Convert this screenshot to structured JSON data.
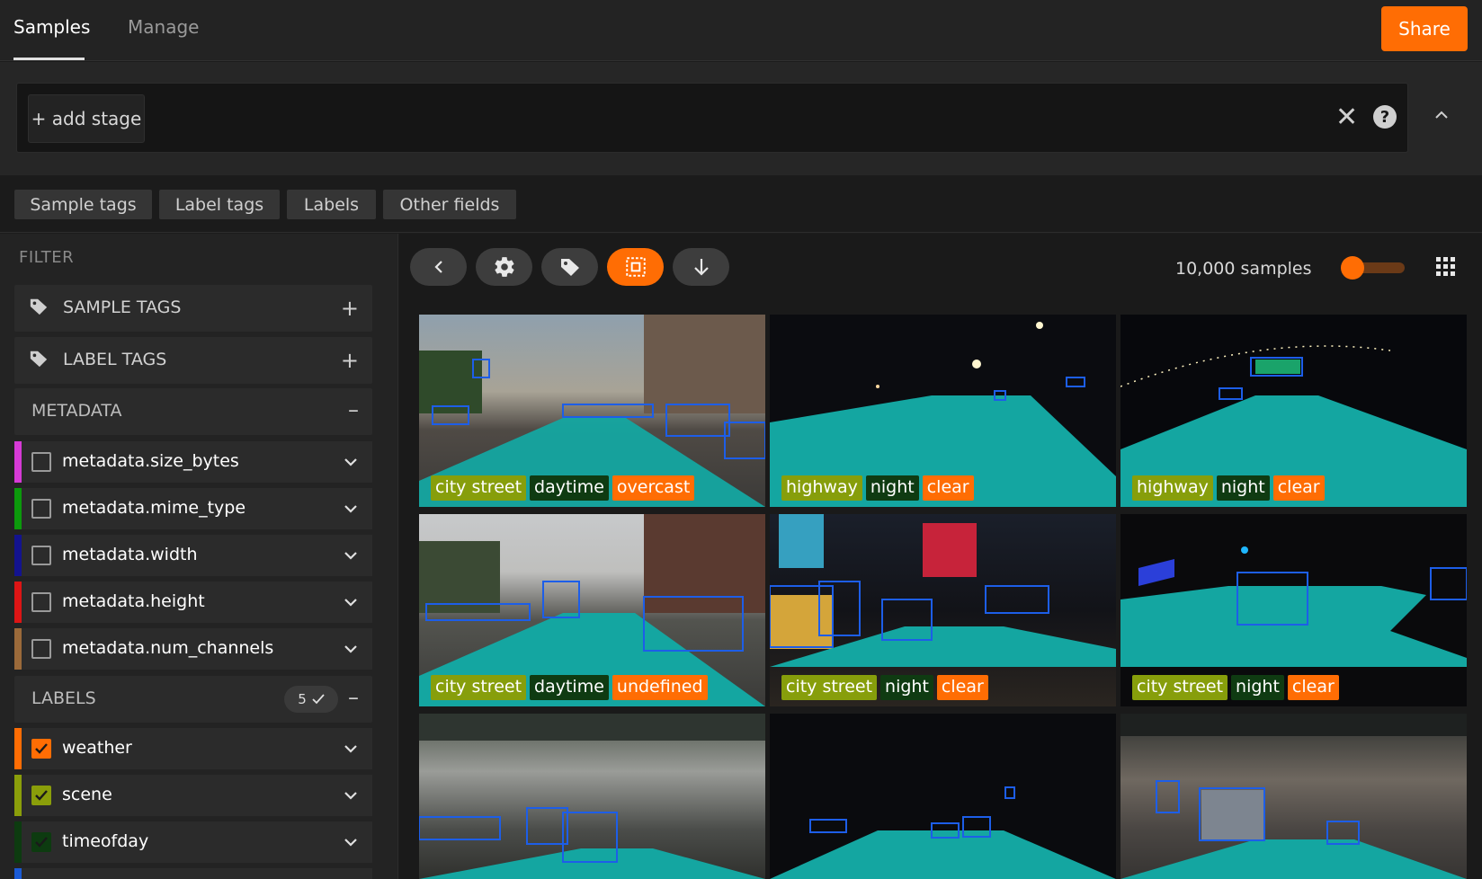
{
  "topbar": {
    "tabs": [
      {
        "label": "Samples"
      },
      {
        "label": "Manage"
      }
    ],
    "share_label": "Share"
  },
  "viewbar": {
    "add_stage_label": "+ add stage",
    "clear_glyph": "✕",
    "help_glyph": "?"
  },
  "sidebar_tabs": [
    {
      "label": "Sample tags"
    },
    {
      "label": "Label tags"
    },
    {
      "label": "Labels"
    },
    {
      "label": "Other fields"
    }
  ],
  "sidebar": {
    "title": "FILTER",
    "groups": {
      "sample_tags": {
        "label": "SAMPLE TAGS"
      },
      "label_tags": {
        "label": "LABEL TAGS"
      },
      "metadata": {
        "label": "METADATA"
      },
      "labels": {
        "label": "LABELS",
        "count": "5"
      }
    },
    "metadata_fields": [
      {
        "label": "metadata.size_bytes",
        "color": "#d63ad6",
        "checked": false
      },
      {
        "label": "metadata.mime_type",
        "color": "#0c9a0c",
        "checked": false
      },
      {
        "label": "metadata.width",
        "color": "#13138f",
        "checked": false
      },
      {
        "label": "metadata.height",
        "color": "#dd1515",
        "checked": false
      },
      {
        "label": "metadata.num_channels",
        "color": "#9b6a3a",
        "checked": false
      }
    ],
    "label_fields": [
      {
        "label": "weather",
        "color": "#ff6d04",
        "checked": true
      },
      {
        "label": "scene",
        "color": "#8a9e0a",
        "checked": true
      },
      {
        "label": "timeofday",
        "color": "#0d3b10",
        "checked": true
      },
      {
        "label": "",
        "color": "#1b5bd6",
        "checked": true
      }
    ]
  },
  "grid": {
    "sample_count": "10,000 samples",
    "zoom_level": 0.05,
    "toolbar": [
      {
        "icon": "chevron-left-icon"
      },
      {
        "icon": "gear-icon"
      },
      {
        "icon": "tag-icon"
      },
      {
        "icon": "patches-icon"
      },
      {
        "icon": "download-icon"
      }
    ],
    "samples": [
      {
        "scene": "city street",
        "timeofday": "daytime",
        "weather": "overcast"
      },
      {
        "scene": "highway",
        "timeofday": "night",
        "weather": "clear"
      },
      {
        "scene": "highway",
        "timeofday": "night",
        "weather": "clear"
      },
      {
        "scene": "city street",
        "timeofday": "daytime",
        "weather": "undefined"
      },
      {
        "scene": "city street",
        "timeofday": "night",
        "weather": "clear"
      },
      {
        "scene": "city street",
        "timeofday": "night",
        "weather": "clear"
      },
      {
        "scene": "",
        "timeofday": "",
        "weather": ""
      },
      {
        "scene": "",
        "timeofday": "",
        "weather": ""
      },
      {
        "scene": "",
        "timeofday": "",
        "weather": ""
      }
    ]
  }
}
